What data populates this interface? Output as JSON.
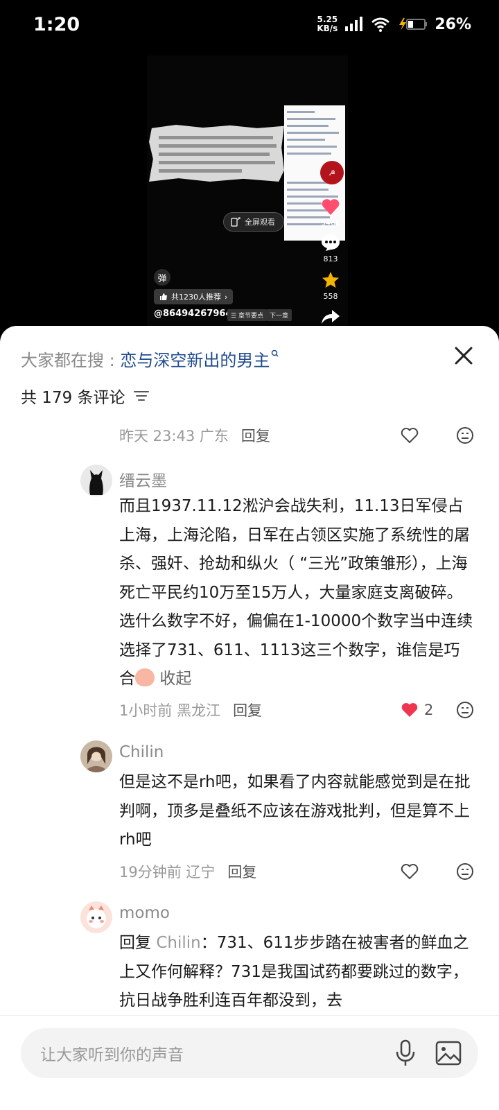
{
  "status_bar": {
    "time": "1:20",
    "net_speed_value": "5.25",
    "net_speed_unit": "KB/s",
    "battery": "26%"
  },
  "video": {
    "fullscreen_label": "全屏观看",
    "danmu_label": "弹",
    "recommend_label": "共1230人推荐",
    "author": "@86494267964",
    "chapter_label": "章节要点",
    "next_label": "下一章",
    "likes": "5466",
    "comments": "813",
    "favorites": "558",
    "accent_like": "#ff4d6d",
    "accent_star": "#f5b400"
  },
  "sheet": {
    "search_prefix": "大家都在搜 : ",
    "search_keyword": "恋与深空新出的男主",
    "comment_count": "共 179 条评论"
  },
  "top_meta": {
    "time": "昨天 23:43",
    "location": "广东",
    "reply": "回复"
  },
  "comments": [
    {
      "name": "缙云墨",
      "text": "而且1937.11.12淞沪会战失利，11.13日军侵占上海，上海沦陷，日军在占领区实施了系统性的屠杀、强奸、抢劫和纵火（ “三光”政策雏形），上海死亡平民约10万至15万人，大量家庭支离破碎。选什么数字不好，偏偏在1-10000个数字当中连续选择了731、611、1113这三个数字，谁信是巧合",
      "collapse": "收起",
      "time": "1小时前",
      "location": "黑龙江",
      "reply": "回复",
      "likes": "2"
    },
    {
      "name": "Chilin",
      "text": "但是这不是rh吧，如果看了内容就能感觉到是在批判啊，顶多是叠纸不应该在游戏批判，但是算不上rh吧",
      "time": "19分钟前",
      "location": "辽宁",
      "reply": "回复"
    },
    {
      "name": "momo",
      "reply_prefix": "回复",
      "reply_to": "Chilin",
      "text": "：731、611步步踏在被害者的鲜血之上又作何解释？731是我国试药都要跳过的数字，抗日战争胜利连百年都没到，去"
    }
  ],
  "input": {
    "placeholder": "让大家听到你的声音"
  },
  "colors": {
    "like_red": "#f0364f",
    "keyword_blue": "#1f4b8f"
  }
}
